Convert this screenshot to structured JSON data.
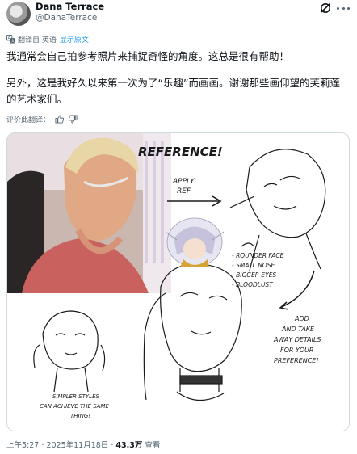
{
  "author": {
    "display_name": "Dana Terrace",
    "handle": "@DanaTerrace"
  },
  "translation": {
    "label": "翻译自 英语",
    "show_original": "显示原文"
  },
  "tweet": {
    "paragraph_1": "我通常会自己拍参考照片来捕捉奇怪的角度。这总是很有帮助！",
    "paragraph_2": "另外，这是我好久以来第一次为了“乐趣”而画画。谢谢那些画仰望的芙莉莲的艺术家们。"
  },
  "rate_translation": {
    "label": "评价此翻译："
  },
  "artwork": {
    "title": "REFERENCE!",
    "apply_ref_line1": "APPLY",
    "apply_ref_line2": "REF",
    "notes": [
      "- ROUNDER FACE",
      "- SMALL NOSE",
      "- BIGGER EYES",
      "- BLOODLUST"
    ],
    "details": [
      "ADD",
      "AND TAKE",
      "AWAY DETAILS",
      "FOR YOUR",
      "PREFERENCE!"
    ],
    "simpler": [
      "SIMPLER STYLES",
      "CAN ACHIEVE THE SAME",
      "THING!"
    ]
  },
  "footer": {
    "time": "上午5:27",
    "separator": "·",
    "date": "2025年11月18日",
    "views": "43.3万",
    "views_label": "查看"
  },
  "icons": {
    "more": "more-icon",
    "grok": "grok-icon",
    "translate": "translate-icon",
    "thumbs_up": "thumbs-up-icon",
    "thumbs_down": "thumbs-down-icon"
  },
  "colors": {
    "text": "#0f1419",
    "secondary": "#536471",
    "link": "#1d9bf0",
    "border": "#cfd9de"
  }
}
